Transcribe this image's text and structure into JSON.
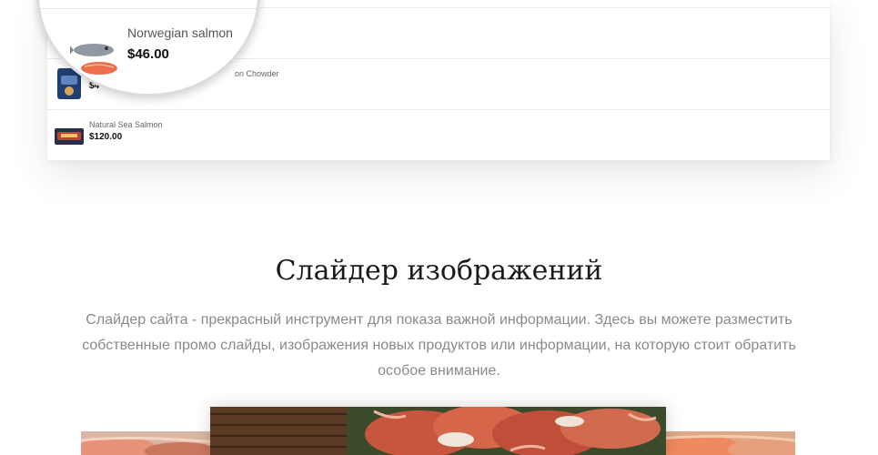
{
  "products": [
    {
      "name": "Norwegian salmon",
      "price": "$46.00",
      "image": "salmon-fillet-icon"
    },
    {
      "name": "Salmon Chowder",
      "price": "$46.00",
      "image": "chowder-can-icon"
    },
    {
      "name": "Natural Sea Salmon",
      "price": "$120.00",
      "image": "salmon-tin-icon"
    }
  ],
  "magnifier": {
    "name": "Norwegian salmon",
    "price": "$46.00",
    "behind_name_fragment": "on Chowder",
    "behind_price_fragment": "$4"
  },
  "section": {
    "title": "Слайдер изображений",
    "description": "Слайдер сайта - прекрасный инструмент для показа важной информации. Здесь вы можете разместить собственные промо слайды, изображения новых продуктов или информации, на которую стоит обратить особое внимание."
  },
  "slider": {
    "slides": [
      "salmon-slide-image",
      "king-crab-slide-image",
      "fish-slide-image"
    ]
  },
  "colors": {
    "text_dark": "#1a1a1a",
    "text_muted": "#8a8a8a",
    "crab": "#c8553d",
    "salmon": "#e9704a"
  }
}
